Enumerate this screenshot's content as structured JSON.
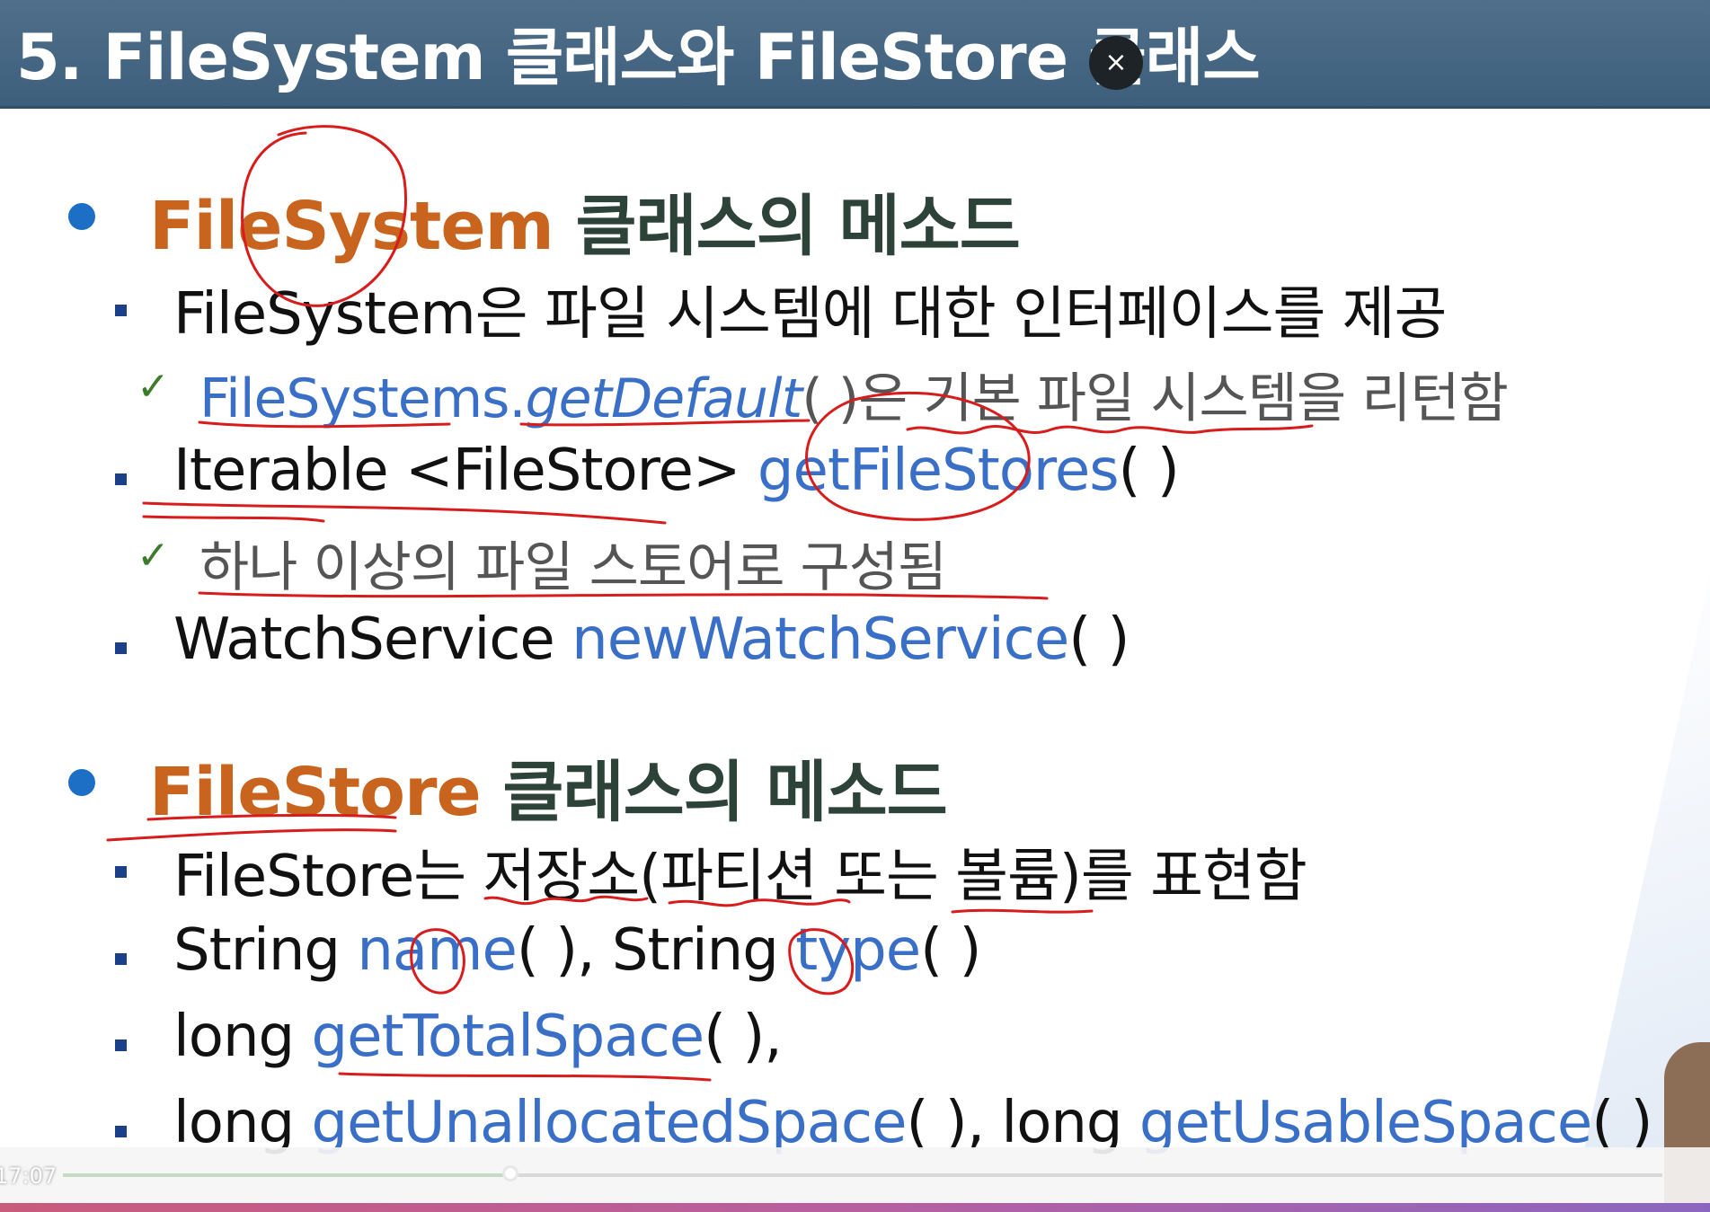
{
  "title": "5. FileSystem 클래스와 FileStore 클래스",
  "close_label": "×",
  "sections": [
    {
      "heading_accent": "FileSystem",
      "heading_rest": " 클래스의 메소드",
      "items": [
        {
          "type": "square",
          "text": "FileSystem은 파일 시스템에 대한 인터페이스를 제공"
        },
        {
          "type": "check",
          "blue": "FileSystems.",
          "blue_italic": "getDefault",
          "text": "( )은 기본 파일 시스템을 리턴함"
        },
        {
          "type": "square",
          "text": "Iterable <FileStore> ",
          "blue": "getFileStores",
          "suffix": "( )"
        },
        {
          "type": "check",
          "text": "하나 이상의 파일 스토어로 구성됨"
        },
        {
          "type": "square",
          "text": "WatchService ",
          "blue": "newWatchService",
          "suffix": "( )"
        }
      ]
    },
    {
      "heading_accent": "FileStore",
      "heading_rest": " 클래스의 메소드",
      "items": [
        {
          "type": "square",
          "text": "FileStore는 저장소(파티션 또는 볼륨)를 표현함"
        },
        {
          "type": "square",
          "text": "String ",
          "blue": "name",
          "mid": "( ), String ",
          "blue2": "type",
          "suffix": "( )"
        },
        {
          "type": "square",
          "text": "long ",
          "blue": "getTotalSpace",
          "suffix": "( ),"
        },
        {
          "type": "square",
          "text": "long ",
          "blue": "getUnallocatedSpace",
          "mid": "( ), long ",
          "blue2": "getUsableSpace",
          "suffix": "( )"
        }
      ]
    }
  ],
  "player": {
    "time": "17:07",
    "progress": 0.28
  },
  "colors": {
    "title_bar": "#4a6a86",
    "heading_accent": "#c8641e",
    "method_blue": "#3a6fc8",
    "bullet": "#1c6fc4",
    "annotation_red": "#d81c1c"
  }
}
